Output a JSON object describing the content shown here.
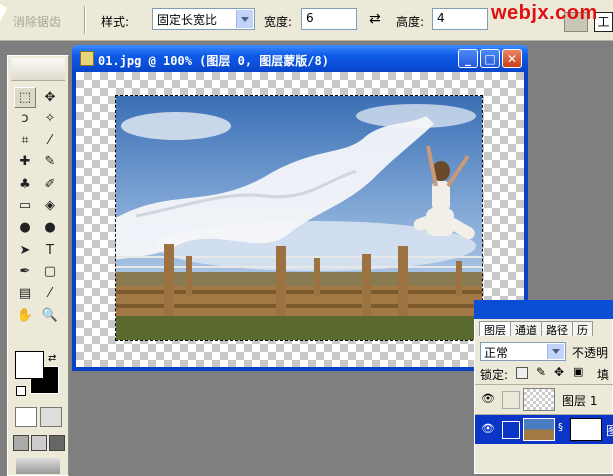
{
  "options_bar": {
    "anti_alias_label": "消除锯齿",
    "style_label": "样式:",
    "style_value": "固定长宽比",
    "width_label": "宽度:",
    "width_value": "6",
    "swap_symbol": "⇄",
    "height_label": "高度:",
    "height_value": "4",
    "workspace_label": "工"
  },
  "watermark": "webjx.com",
  "document": {
    "title": "01.jpg @ 100% (图层 0, 图层蒙版/8)",
    "minimize": "_",
    "maximize": "□",
    "close": "✕"
  },
  "toolbox": {
    "tools": [
      "marquee-icon",
      "move-icon",
      "lasso-icon",
      "magic-wand-icon",
      "crop-icon",
      "slice-icon",
      "healing-icon",
      "brush-icon",
      "stamp-icon",
      "history-brush-icon",
      "eraser-icon",
      "bucket-icon",
      "blur-icon",
      "dodge-icon",
      "path-select-icon",
      "type-icon",
      "pen-icon",
      "shape-icon",
      "notes-icon",
      "eyedropper-icon",
      "hand-icon",
      "zoom-icon"
    ],
    "tool_glyphs": [
      "⬚",
      "✥",
      "ↄ",
      "✧",
      "⌗",
      "⁄",
      "✚",
      "✎",
      "♣",
      "✐",
      "▭",
      "◈",
      "●",
      "●",
      "➤",
      "T",
      "✒",
      "▢",
      "▤",
      "⁄",
      "✋",
      "🔍"
    ],
    "foreground_color": "#ffffff",
    "background_color": "#000000"
  },
  "layers_panel": {
    "tabs": [
      "图层",
      "通道",
      "路径",
      "历"
    ],
    "blend_mode": "正常",
    "opacity_label": "不透明",
    "lock_label": "锁定:",
    "fill_label": "填",
    "layers": [
      {
        "name": "图层 1",
        "selected": false
      },
      {
        "name": "图",
        "selected": true
      }
    ]
  }
}
